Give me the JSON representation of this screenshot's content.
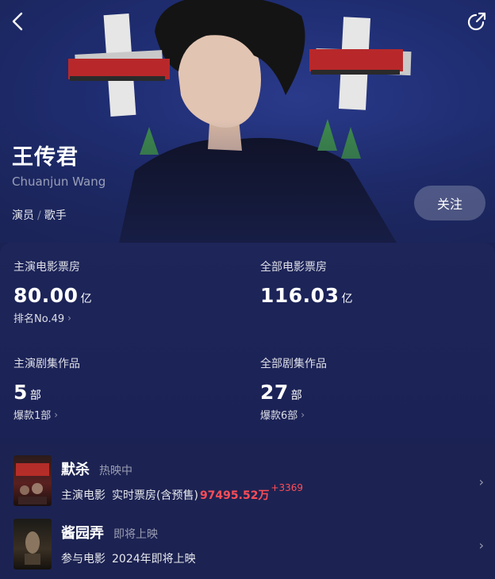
{
  "header": {
    "back_icon": "chevron-left-icon",
    "share_icon": "share-icon"
  },
  "profile": {
    "name_cn": "王传君",
    "name_en": "Chuanjun Wang",
    "roles": [
      "演员",
      "歌手"
    ],
    "role_separator": "/",
    "follow_label": "关注"
  },
  "stats": {
    "lead_box_office": {
      "label": "主演电影票房",
      "value": "80.00",
      "unit": "亿",
      "sub": "排名No.49"
    },
    "total_box_office": {
      "label": "全部电影票房",
      "value": "116.03",
      "unit": "亿"
    },
    "lead_series": {
      "label": "主演剧集作品",
      "value": "5",
      "unit": "部",
      "sub": "爆款1部"
    },
    "total_series": {
      "label": "全部剧集作品",
      "value": "27",
      "unit": "部",
      "sub": "爆款6部"
    }
  },
  "works": [
    {
      "title": "默杀",
      "status": "热映中",
      "role_type": "主演电影",
      "box_label": "实时票房(含预售)",
      "box_value": "97495.52万",
      "box_delta": "+3369",
      "poster_text": "《误杀》导演\n新作《默杀》"
    },
    {
      "title": "酱园弄",
      "status": "即将上映",
      "role_type": "参与电影",
      "release_info": "2024年即将上映"
    }
  ],
  "colors": {
    "accent_red": "#ff4d57",
    "background": "#1a2153"
  }
}
